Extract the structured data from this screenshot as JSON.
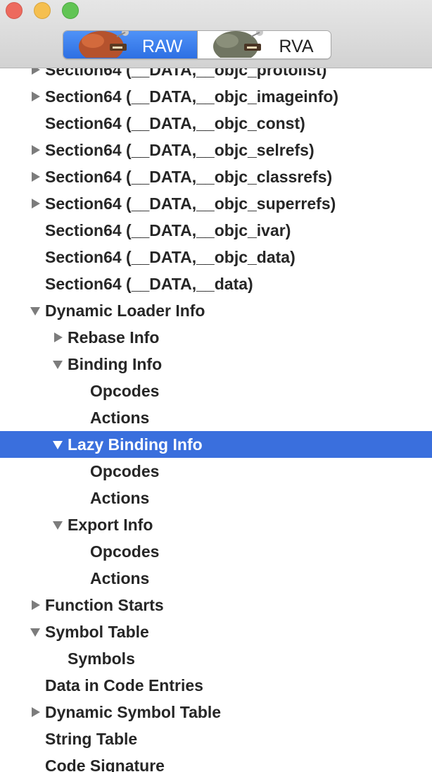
{
  "toolbar": {
    "raw_label": "RAW",
    "rva_label": "RVA",
    "selected": "RAW"
  },
  "outline": {
    "rows": [
      {
        "label": "Section64 (__DATA,__objc_protolist)",
        "level": 0,
        "disclosure": "collapsed",
        "selected": false,
        "clipped_top": true
      },
      {
        "label": "Section64 (__DATA,__objc_imageinfo)",
        "level": 0,
        "disclosure": "collapsed",
        "selected": false
      },
      {
        "label": "Section64 (__DATA,__objc_const)",
        "level": 0,
        "disclosure": "none",
        "selected": false
      },
      {
        "label": "Section64 (__DATA,__objc_selrefs)",
        "level": 0,
        "disclosure": "collapsed",
        "selected": false
      },
      {
        "label": "Section64 (__DATA,__objc_classrefs)",
        "level": 0,
        "disclosure": "collapsed",
        "selected": false
      },
      {
        "label": "Section64 (__DATA,__objc_superrefs)",
        "level": 0,
        "disclosure": "collapsed",
        "selected": false
      },
      {
        "label": "Section64 (__DATA,__objc_ivar)",
        "level": 0,
        "disclosure": "none",
        "selected": false
      },
      {
        "label": "Section64 (__DATA,__objc_data)",
        "level": 0,
        "disclosure": "none",
        "selected": false
      },
      {
        "label": "Section64 (__DATA,__data)",
        "level": 0,
        "disclosure": "none",
        "selected": false
      },
      {
        "label": "Dynamic Loader Info",
        "level": 0,
        "disclosure": "expanded",
        "selected": false
      },
      {
        "label": "Rebase Info",
        "level": 1,
        "disclosure": "collapsed",
        "selected": false
      },
      {
        "label": "Binding Info",
        "level": 1,
        "disclosure": "expanded",
        "selected": false
      },
      {
        "label": "Opcodes",
        "level": 2,
        "disclosure": "none",
        "selected": false
      },
      {
        "label": "Actions",
        "level": 2,
        "disclosure": "none",
        "selected": false
      },
      {
        "label": "Lazy Binding Info",
        "level": 1,
        "disclosure": "expanded",
        "selected": true
      },
      {
        "label": "Opcodes",
        "level": 2,
        "disclosure": "none",
        "selected": false
      },
      {
        "label": "Actions",
        "level": 2,
        "disclosure": "none",
        "selected": false
      },
      {
        "label": "Export Info",
        "level": 1,
        "disclosure": "expanded",
        "selected": false
      },
      {
        "label": "Opcodes",
        "level": 2,
        "disclosure": "none",
        "selected": false
      },
      {
        "label": "Actions",
        "level": 2,
        "disclosure": "none",
        "selected": false
      },
      {
        "label": "Function Starts",
        "level": 0,
        "disclosure": "collapsed",
        "selected": false
      },
      {
        "label": "Symbol Table",
        "level": 0,
        "disclosure": "expanded",
        "selected": false
      },
      {
        "label": "Symbols",
        "level": 1,
        "disclosure": "none",
        "selected": false
      },
      {
        "label": "Data in Code Entries",
        "level": 0,
        "disclosure": "none",
        "selected": false
      },
      {
        "label": "Dynamic Symbol Table",
        "level": 0,
        "disclosure": "collapsed",
        "selected": false
      },
      {
        "label": "String Table",
        "level": 0,
        "disclosure": "none",
        "selected": false
      },
      {
        "label": "Code Signature",
        "level": 0,
        "disclosure": "none",
        "selected": false
      }
    ]
  },
  "colors": {
    "selection": "#3a6fdd",
    "segment_selected": "#2d6fe3",
    "text": "#262626",
    "disclosure": "#7c7c7c"
  },
  "icons": {
    "raw_thumbnail": "machine-thumbnail-icon",
    "rva_thumbnail": "machine-thumbnail-icon",
    "collapsed": "disclosure-triangle-right-icon",
    "expanded": "disclosure-triangle-down-icon"
  }
}
